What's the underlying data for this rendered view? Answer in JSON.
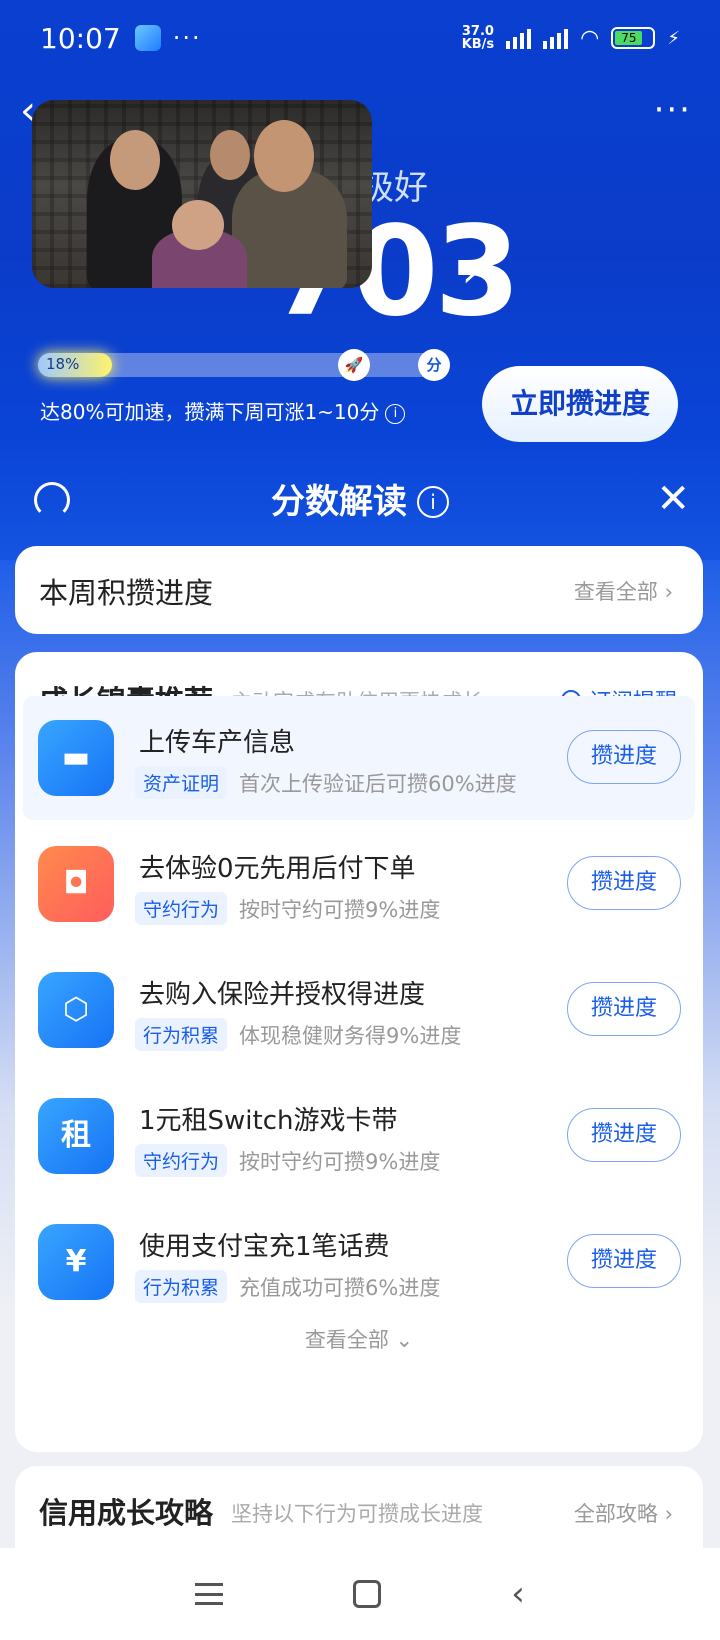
{
  "status_bar": {
    "time": "10:07",
    "more": "···",
    "net_speed": "37.0\nKB/s",
    "battery": "75"
  },
  "header": {
    "back_icon": "‹",
    "more_icon": "···"
  },
  "credit": {
    "level_text": "极好",
    "score": "703",
    "score_arrow": "›"
  },
  "progress": {
    "value": 0.18,
    "label": "18%",
    "node_rocket": "🚀",
    "node_end": "分",
    "note": "达80%可加速，攒满下周可涨1~10分",
    "cta": "立即攒进度"
  },
  "sheet": {
    "title": "分数解读",
    "info": "i",
    "close": "✕"
  },
  "week_card": {
    "title": "本周积攒进度",
    "link": "查看全部 ›"
  },
  "growth": {
    "title": "成长锦囊推荐",
    "subtitle": "主动完成有助信用更快成长",
    "subscribe": "订阅提醒",
    "tasks": [
      {
        "name": "上传车产信息",
        "tag": "资产证明",
        "desc": "首次上传验证后可攒60%进度",
        "button": "攒进度",
        "icon": "car-icon"
      },
      {
        "name": "去体验0元先用后付下单",
        "tag": "守约行为",
        "desc": "按时守约可攒9%进度",
        "button": "攒进度",
        "icon": "bag-icon"
      },
      {
        "name": "去购入保险并授权得进度",
        "tag": "行为积累",
        "desc": "体现稳健财务得9%进度",
        "button": "攒进度",
        "icon": "shield-icon"
      },
      {
        "name": "1元租Switch游戏卡带",
        "tag": "守约行为",
        "desc": "按时守约可攒9%进度",
        "button": "攒进度",
        "icon": "rent-icon"
      },
      {
        "name": "使用支付宝充1笔话费",
        "tag": "行为积累",
        "desc": "充值成功可攒6%进度",
        "button": "攒进度",
        "icon": "phone-bill-icon"
      }
    ],
    "view_all": "查看全部 ⌄"
  },
  "strategy": {
    "title": "信用成长攻略",
    "subtitle": "坚持以下行为可攒成长进度",
    "link": "全部攻略 ›"
  },
  "icons": {
    "rent_char": "租",
    "yen_char": "¥"
  }
}
